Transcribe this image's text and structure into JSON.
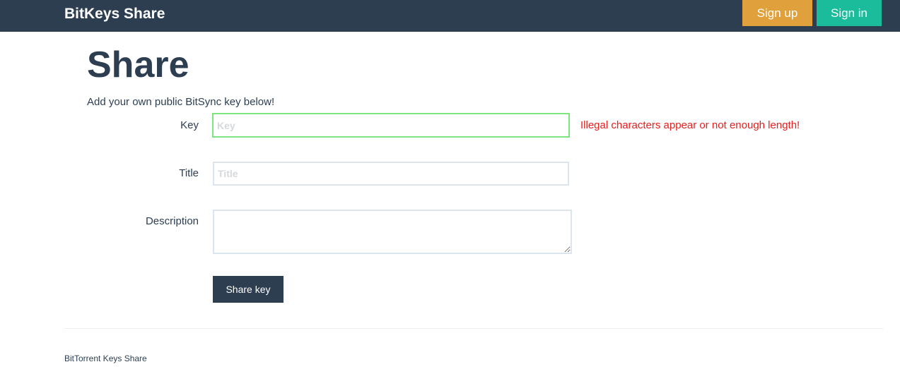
{
  "navbar": {
    "brand": "BitKeys Share",
    "signup_label": "Sign up",
    "signin_label": "Sign in"
  },
  "main": {
    "title": "Share",
    "intro": "Add your own public BitSync key below!"
  },
  "form": {
    "key": {
      "label": "Key",
      "placeholder": "Key",
      "value": ""
    },
    "title": {
      "label": "Title",
      "placeholder": "Title",
      "value": ""
    },
    "description": {
      "label": "Description",
      "value": ""
    },
    "key_error": "Illegal characters appear or not enough length!",
    "submit_label": "Share key"
  },
  "footer": {
    "text": "BitTorrent Keys Share"
  },
  "colors": {
    "navbar_bg": "#2c3e50",
    "signup_bg": "#e0a03c",
    "signin_bg": "#1abc9c",
    "valid_border": "#7ee57e",
    "error_text": "#e81d1d"
  }
}
